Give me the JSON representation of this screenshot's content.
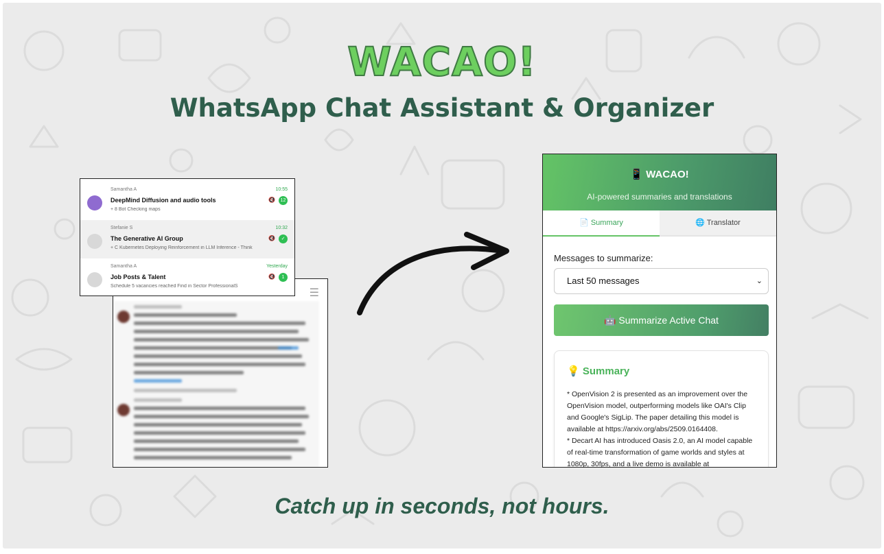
{
  "hero": {
    "title": "WACAO!",
    "subtitle": "WhatsApp Chat Assistant & Organizer",
    "tagline": "Catch up in seconds, not hours."
  },
  "chat_list": {
    "rows": [
      {
        "sender": "Samantha A",
        "time": "10:55",
        "title": "DeepMind Diffusion and audio tools",
        "preview": "+ 8 Bot Checking maps",
        "badge": "12"
      },
      {
        "sender": "Stefanie S",
        "time": "10:32",
        "title": "The Generative AI Group",
        "preview": "+ C Kubernetes Deploying Reinforcement in LLM Inference - Think",
        "badge": "✓"
      },
      {
        "sender": "Samantha A",
        "time": "Yesterday",
        "title": "Job Posts & Talent",
        "preview": "Schedule 5 vacancies reached Find in Sector ProfessionalS",
        "badge": "1"
      }
    ]
  },
  "popup": {
    "title_icon": "📱",
    "title": "WACAO!",
    "subtitle": "AI-powered summaries and translations",
    "tabs": [
      {
        "icon": "📄",
        "label": "Summary",
        "active": true
      },
      {
        "icon": "🌐",
        "label": "Translator",
        "active": false
      }
    ],
    "messages_label": "Messages to summarize:",
    "messages_select": {
      "value": "Last 50 messages"
    },
    "summarize_button": {
      "icon": "🤖",
      "label": "Summarize Active Chat"
    },
    "summary": {
      "icon": "💡",
      "heading": "Summary",
      "lines": [
        "* OpenVision 2 is presented as an improvement over the",
        "OpenVision model, outperforming models like OAI's Clip",
        "and Google's SigLip. The paper detailing this model is",
        "available at https://arxiv.org/abs/2509.0164408.",
        "* Decart AI has introduced Oasis 2.0, an AI model capable",
        "of real-time transformation of game worlds and styles at",
        "1080p, 30fps, and a live demo is available at"
      ]
    }
  },
  "colors": {
    "brand_green": "#6dcf5f",
    "brand_dark": "#2f5e4c",
    "accent": "#4ab35a"
  }
}
